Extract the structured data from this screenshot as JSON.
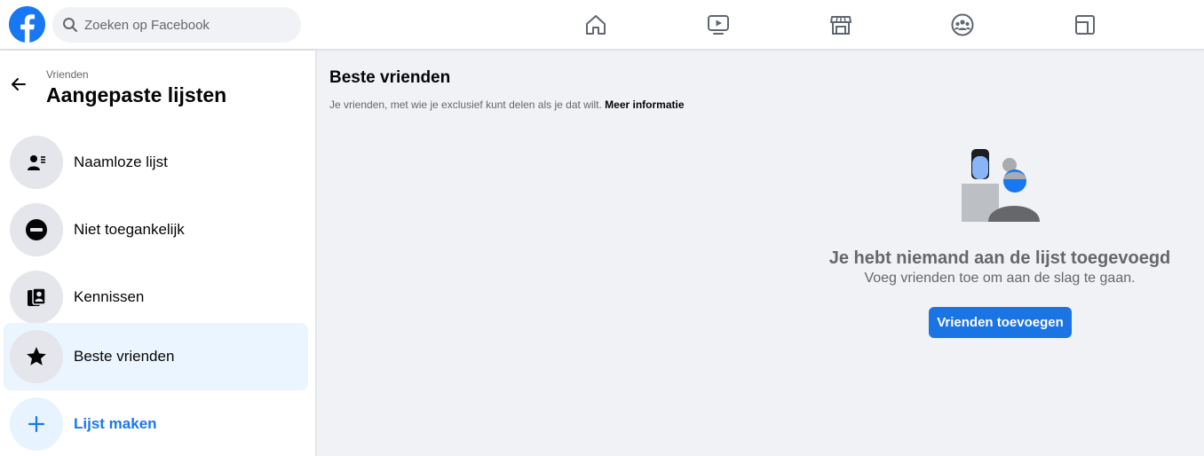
{
  "topbar": {
    "search": {
      "placeholder": "Zoeken op Facebook",
      "value": ""
    },
    "nav": [
      {
        "icon": "home-icon"
      },
      {
        "icon": "watch-icon"
      },
      {
        "icon": "marketplace-icon"
      },
      {
        "icon": "groups-icon"
      },
      {
        "icon": "gaming-icon"
      }
    ]
  },
  "sidebar": {
    "breadcrumb": "Vrienden",
    "title": "Aangepaste lijsten",
    "items": [
      {
        "label": "Naamloze lijst",
        "icon": "person-list-icon"
      },
      {
        "label": "Niet toegankelijk",
        "icon": "restricted-icon"
      },
      {
        "label": "Kennissen",
        "icon": "acquaintances-icon"
      },
      {
        "label": "Beste vrienden",
        "icon": "star-icon",
        "active": true
      },
      {
        "label": "Lijst maken",
        "icon": "plus-icon"
      }
    ]
  },
  "main": {
    "title": "Beste vrienden",
    "subtitle": "Je vrienden, met wie je exclusief kunt delen als je dat wilt.",
    "more_link": "Meer informatie",
    "empty_title": "Je hebt niemand aan de lijst toegevoegd",
    "empty_subtitle": "Voeg vrienden toe om aan de slag te gaan.",
    "add_button": "Vrienden toevoegen"
  },
  "colors": {
    "brand": "#1877f2",
    "button": "#1b74e4",
    "active_bg": "#ebf5ff",
    "page_bg": "#f0f2f5"
  }
}
